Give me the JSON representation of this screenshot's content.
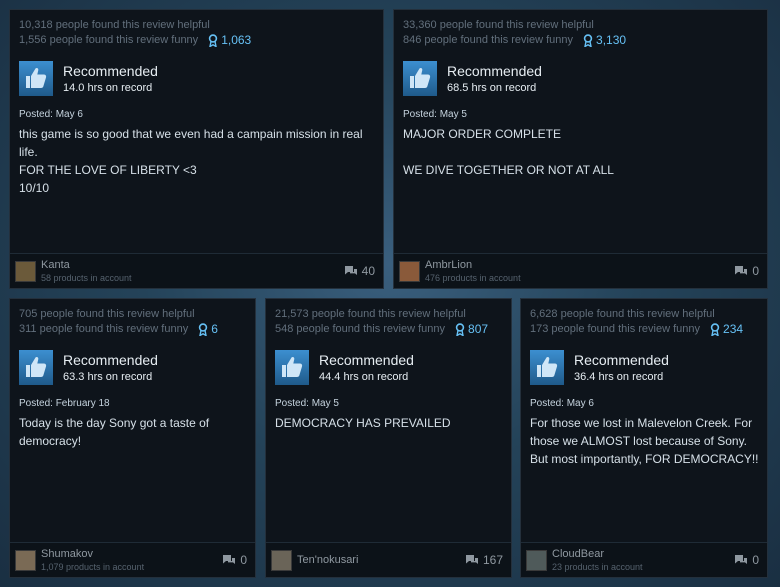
{
  "reviews": [
    {
      "helpful": "10,318 people found this review helpful",
      "funny": "1,556 people found this review funny",
      "awards": "1,063",
      "recommendation": "Recommended",
      "hours": "14.0 hrs on record",
      "posted": "Posted: May 6",
      "text": "this game is so good that we even had a campain mission in real life.\nFOR THE LOVE OF LIBERTY <3\n10/10",
      "user": "Kanta",
      "products": "58 products in account",
      "comments": "40"
    },
    {
      "helpful": "33,360 people found this review helpful",
      "funny": "846 people found this review funny",
      "awards": "3,130",
      "recommendation": "Recommended",
      "hours": "68.5 hrs on record",
      "posted": "Posted: May 5",
      "text": "MAJOR ORDER COMPLETE\n\nWE DIVE TOGETHER OR NOT AT ALL",
      "user": "AmbrLion",
      "products": "476 products in account",
      "comments": "0"
    },
    {
      "helpful": "705 people found this review helpful",
      "funny": "311 people found this review funny",
      "awards": "6",
      "recommendation": "Recommended",
      "hours": "63.3 hrs on record",
      "posted": "Posted: February 18",
      "text": "Today is the day Sony got a taste of democracy!",
      "user": "Shumakov",
      "products": "1,079 products in account",
      "comments": "0"
    },
    {
      "helpful": "21,573 people found this review helpful",
      "funny": "548 people found this review funny",
      "awards": "807",
      "recommendation": "Recommended",
      "hours": "44.4 hrs on record",
      "posted": "Posted: May 5",
      "text": "DEMOCRACY HAS PREVAILED",
      "user": "Ten'nokusari",
      "products": "",
      "comments": "167"
    },
    {
      "helpful": "6,628 people found this review helpful",
      "funny": "173 people found this review funny",
      "awards": "234",
      "recommendation": "Recommended",
      "hours": "36.4 hrs on record",
      "posted": "Posted: May 6",
      "text": "For those we lost in Malevelon Creek. For those we ALMOST lost because of Sony. But most importantly, FOR DEMOCRACY!!",
      "user": "CloudBear",
      "products": "23 products in account",
      "comments": "0"
    }
  ],
  "icons": {
    "thumb": "thumbs-up-icon",
    "award": "award-ribbon-icon",
    "comment": "comment-bubble-icon"
  },
  "colors": {
    "accent": "#66c0f4",
    "card_bg": "#0e141b",
    "thumb_bg": "#2a6b9e"
  }
}
